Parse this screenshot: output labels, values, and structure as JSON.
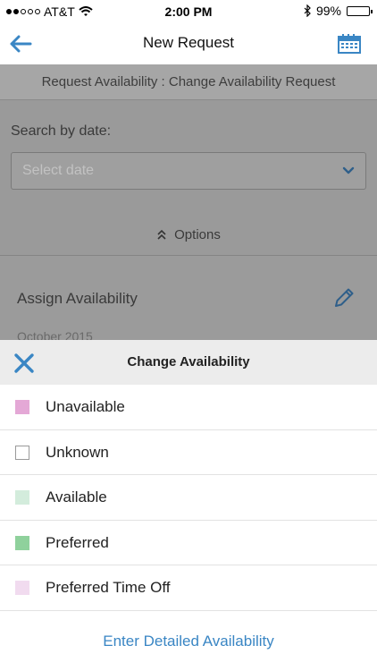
{
  "status_bar": {
    "carrier": "AT&T",
    "time": "2:00 PM",
    "battery": "99%",
    "icons": [
      "signal-dots-icon",
      "wifi-icon",
      "bluetooth-icon",
      "battery-icon"
    ]
  },
  "nav": {
    "title": "New Request",
    "back_icon": "arrow-left-icon",
    "calendar_icon": "calendar-icon",
    "accent_color": "#3a86c4"
  },
  "request": {
    "header": "Request Availability : Change Availability Request",
    "search_label": "Search by date:",
    "date_placeholder": "Select date",
    "options_label": "Options",
    "assign_label": "Assign Availability",
    "month_label": "October 2015"
  },
  "sheet": {
    "title": "Change Availability",
    "close_icon": "close-icon",
    "options": [
      {
        "label": "Unavailable",
        "color": "#e4a8d6",
        "border": "#e4a8d6"
      },
      {
        "label": "Unknown",
        "color": "#ffffff",
        "border": "#9a9a9a"
      },
      {
        "label": "Available",
        "color": "#d3ecdc",
        "border": "#d3ecdc"
      },
      {
        "label": "Preferred",
        "color": "#8fd19c",
        "border": "#8fd19c"
      },
      {
        "label": "Preferred Time Off",
        "color": "#f1dbef",
        "border": "#f1dbef"
      }
    ],
    "detail_link": "Enter Detailed Availability"
  }
}
